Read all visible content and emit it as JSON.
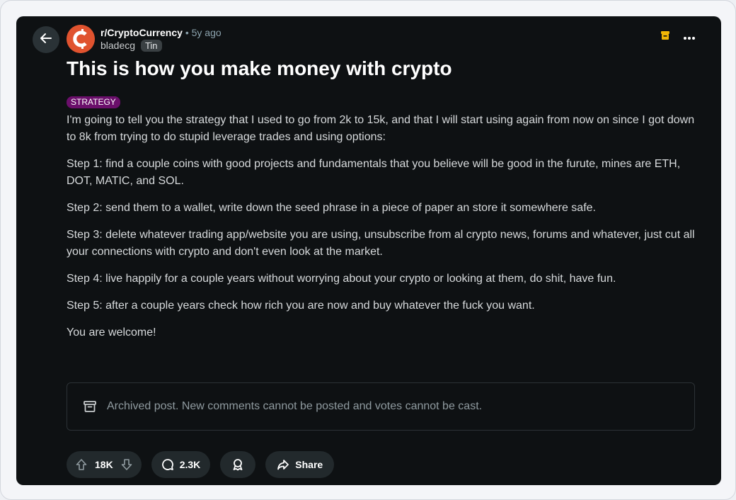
{
  "post": {
    "subreddit": "r/CryptoCurrency",
    "separator": "•",
    "age": "5y ago",
    "author": "bladecg",
    "author_flair": "Tin",
    "title": "This is how you make money with crypto",
    "flair": "STRATEGY",
    "paragraphs": [
      "I'm going to tell you the strategy that I used to go from 2k to 15k, and that I will start using again from now on since I got down to 8k from trying to do stupid leverage trades and using options:",
      "Step 1: find a couple coins with good projects and fundamentals that you believe will be good in the furute, mines are ETH, DOT, MATIC, and SOL.",
      "Step 2: send them to a wallet, write down the seed phrase in a piece of paper an store it somewhere safe.",
      "Step 3: delete whatever trading app/website you are using, unsubscribe from al crypto news, forums and whatever, just cut all your connections with crypto and don't even look at the market.",
      "Step 4: live happily for a couple years without worrying about your crypto or looking at them, do shit, have fun.",
      "Step 5: after a couple years check how rich you are now and buy whatever the fuck you want.",
      "You are welcome!"
    ],
    "archived_notice": "Archived post. New comments cannot be posted and votes cannot be cast."
  },
  "actions": {
    "votes": "18K",
    "comments": "2.3K",
    "share": "Share"
  },
  "icons": {
    "back": "arrow-left-icon",
    "subreddit_avatar": "cryptocurrency-logo",
    "archive_badge": "archive-box-icon",
    "more": "more-horizontal-icon",
    "upvote": "upvote-arrow-icon",
    "downvote": "downvote-arrow-icon",
    "comment": "comment-bubble-icon",
    "award": "award-icon",
    "share": "share-arrow-icon"
  },
  "colors": {
    "background": "#0e1113",
    "flair": "#6b0f6b",
    "avatar": "#e0532f",
    "archive_badge": "#f2b705"
  }
}
